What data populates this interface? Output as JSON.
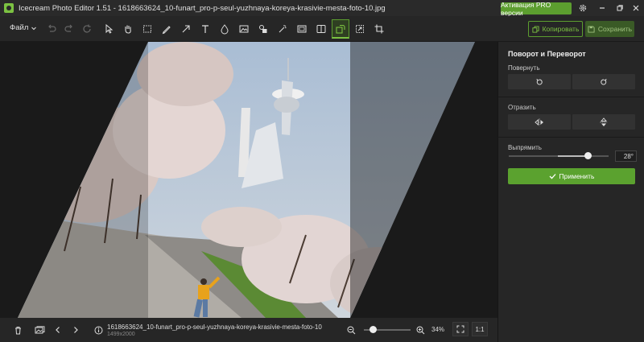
{
  "window": {
    "title": "Icecream Photo Editor 1.51 - 1618663624_10-funart_pro-p-seul-yuzhnaya-koreya-krasivie-mesta-foto-10.jpg",
    "pro_button": "Активация PRO версии"
  },
  "toolbar": {
    "file_menu": "Файл",
    "copy_label": "Копировать",
    "save_label": "Сохранить",
    "active_tool": "rotate-tool",
    "accent_color": "#7cc242"
  },
  "panel": {
    "title": "Поворот и Переворот",
    "rotate_label": "Повернуть",
    "flip_label": "Отразить",
    "straighten_label": "Выпрямить",
    "straighten_level": 0.78,
    "angle_value": "28°",
    "apply_label": "Применить"
  },
  "bottom": {
    "filename": "1618663624_10-funart_pro-p-seul-yuzhnaya-koreya-krasivie-mesta-foto-10",
    "dimensions": "1499x2000",
    "zoom_value": "34%",
    "actual_size": "1:1",
    "zoom_level": 0.2
  }
}
